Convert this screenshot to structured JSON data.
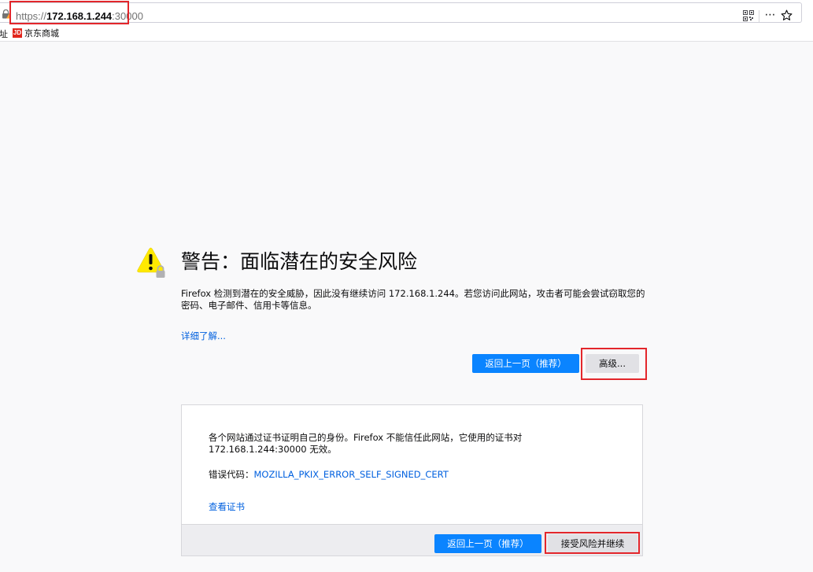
{
  "urlbar": {
    "scheme": "https://",
    "host": "172.168.1.244",
    "port": ":30000",
    "more_icon": "⋯"
  },
  "bookmarks": {
    "cut_label": "址",
    "items": [
      {
        "icon_text": "JD",
        "label": "京东商城"
      }
    ]
  },
  "page": {
    "title": "警告：面临潜在的安全风险",
    "description": "Firefox 检测到潜在的安全威胁，因此没有继续访问 172.168.1.244。若您访问此网站，攻击者可能会尝试窃取您的密码、电子邮件、信用卡等信息。",
    "learn_more": "详细了解...",
    "back_button": "返回上一页（推荐）",
    "advanced_button": "高级..."
  },
  "advanced_panel": {
    "text": "各个网站通过证书证明自己的身份。Firefox 不能信任此网站，它使用的证书对 172.168.1.244:30000 无效。",
    "error_label": "错误代码：",
    "error_code": "MOZILLA_PKIX_ERROR_SELF_SIGNED_CERT",
    "view_certificate": "查看证书",
    "back_button": "返回上一页（推荐）",
    "accept_button": "接受风险并继续"
  },
  "colors": {
    "accent": "#0a84ff",
    "link": "#0060df",
    "highlight": "#e3262b",
    "warning": "#ffe900"
  }
}
